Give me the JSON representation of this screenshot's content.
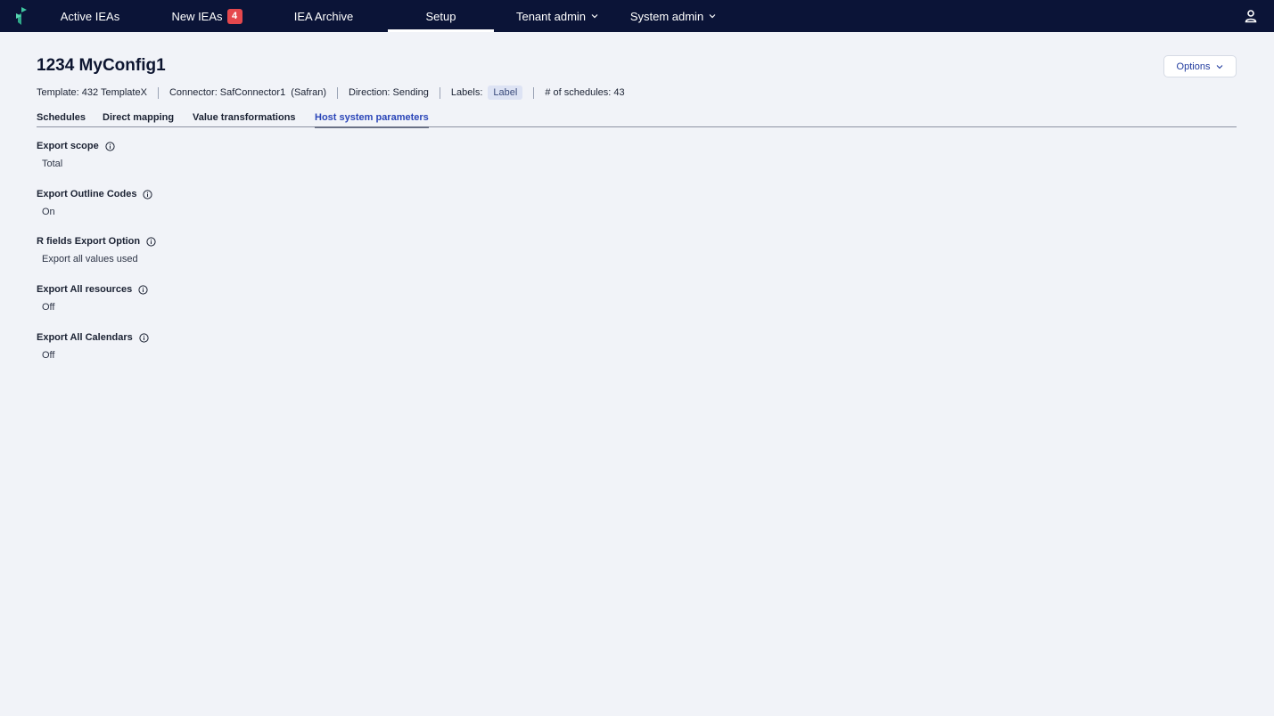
{
  "nav": {
    "items": [
      {
        "label": "Active IEAs"
      },
      {
        "label": "New IEAs",
        "badge": "4"
      },
      {
        "label": "IEA Archive"
      },
      {
        "label": "Setup",
        "active": true
      },
      {
        "label": "Tenant admin"
      },
      {
        "label": "System admin"
      }
    ],
    "icons": {
      "logo": "app-logo",
      "user": "user-icon"
    },
    "colors": {
      "bar": "#0b1437",
      "badge": "#e5484d"
    }
  },
  "header": {
    "title": "1234 MyConfig1",
    "options_label": "Options",
    "meta": {
      "template": "Template: 432 TemplateX",
      "connector": "Connector: SafConnector1  (Safran)",
      "direction": "Direction: Sending",
      "labels_label": "Labels:",
      "label_chip": "Label",
      "schedules": "# of schedules: 43"
    }
  },
  "tabs": [
    {
      "label": "Schedules"
    },
    {
      "label": "Direct mapping"
    },
    {
      "label": "Value transformations"
    },
    {
      "label": "Host system parameters",
      "active": true
    }
  ],
  "parameters": [
    {
      "label": "Export scope",
      "value": "Total"
    },
    {
      "label": "Export Outline Codes",
      "value": "On"
    },
    {
      "label": "R fields Export Option",
      "value": "Export all values used"
    },
    {
      "label": "Export All resources",
      "value": "Off"
    },
    {
      "label": "Export All Calendars",
      "value": "Off"
    }
  ],
  "accent_color": "#2a45b8"
}
